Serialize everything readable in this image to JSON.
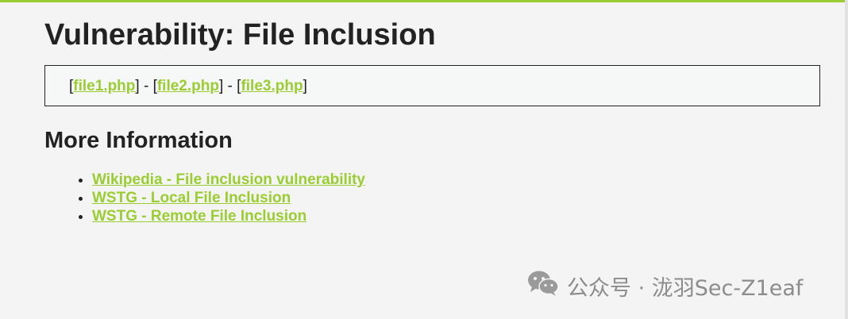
{
  "page": {
    "title": "Vulnerability: File Inclusion"
  },
  "files": [
    {
      "label": "file1.php"
    },
    {
      "label": "file2.php"
    },
    {
      "label": "file3.php"
    }
  ],
  "separators": {
    "open": "[",
    "close": "]",
    "dash": " - "
  },
  "more_info": {
    "heading": "More Information",
    "links": [
      {
        "label": "Wikipedia - File inclusion vulnerability"
      },
      {
        "label": "WSTG - Local File Inclusion"
      },
      {
        "label": "WSTG - Remote File Inclusion"
      }
    ]
  },
  "watermark": {
    "text": "公众号 · 泷羽Sec-Z1eaf",
    "icon": "wechat-icon"
  },
  "colors": {
    "accent": "#9acd32",
    "background": "#f4f4f4",
    "text": "#222222",
    "box_background": "#f6f7f7"
  }
}
